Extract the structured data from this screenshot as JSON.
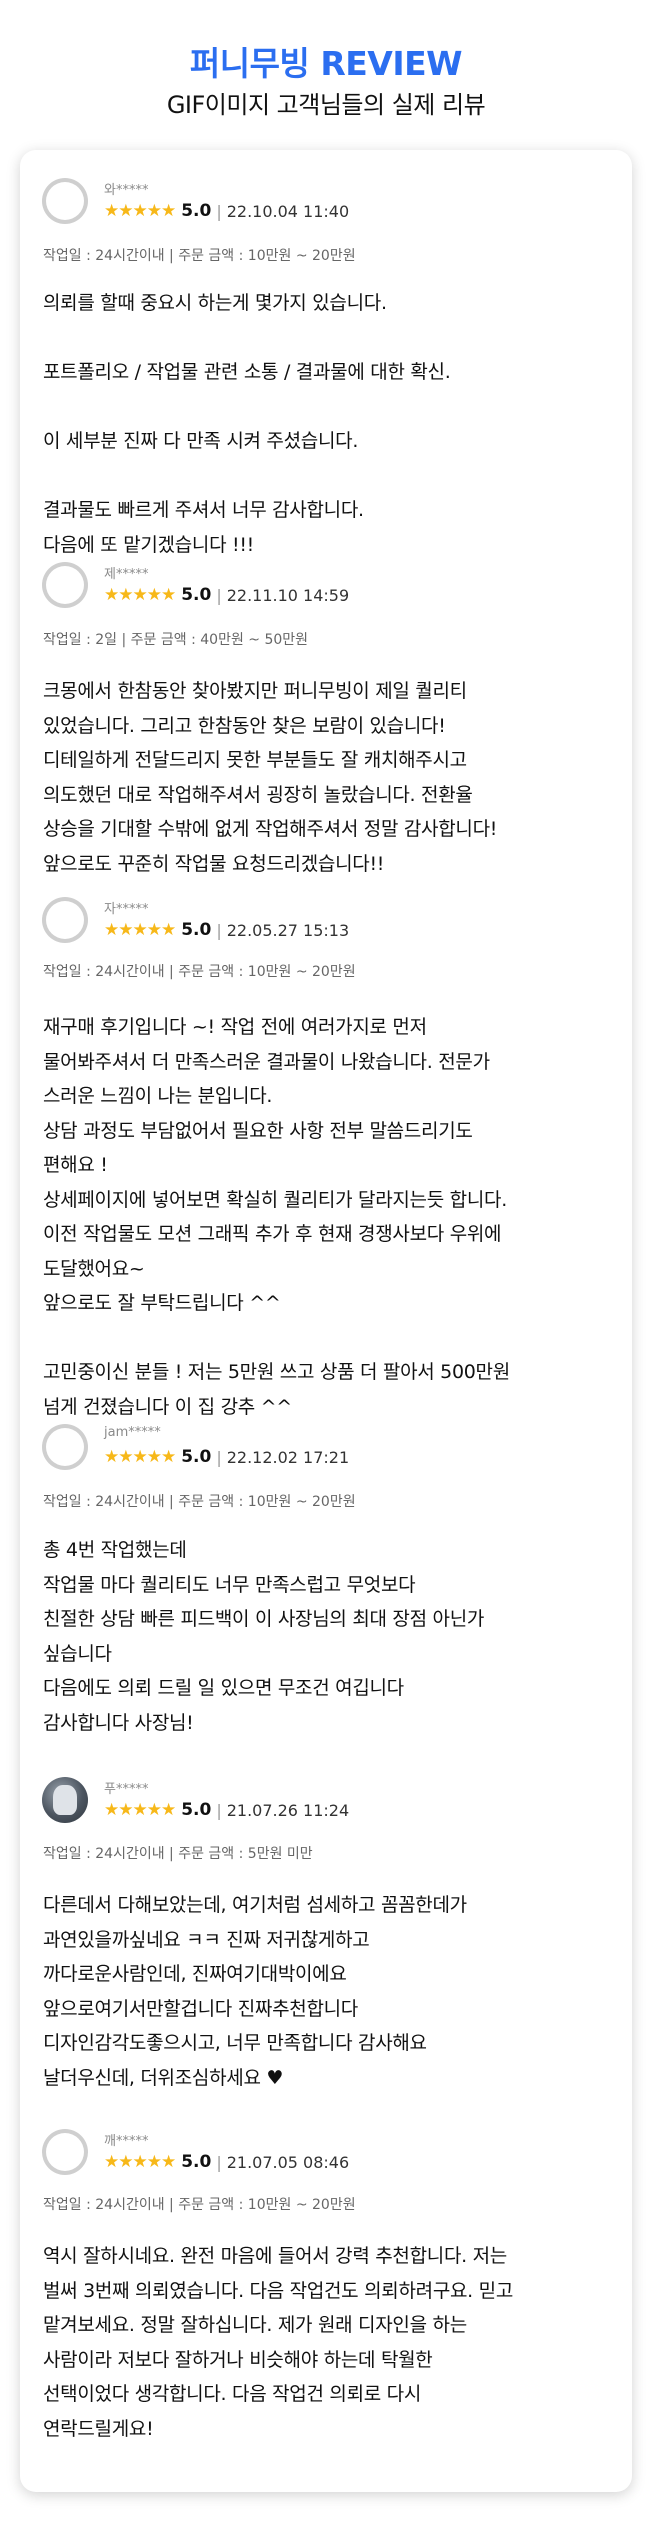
{
  "header": {
    "brand": "퍼니무빙 REVIEW",
    "subtitle": "GIF이미지 고객님들의 실제 리뷰"
  },
  "colors": {
    "brand": "#2b6ef0",
    "star": "#f7b819"
  },
  "reviews": [
    {
      "name": "와*****",
      "stars": "★★★★★",
      "score": "5.0",
      "separator": "|",
      "date": "22.10.04 11:40",
      "meta": "작업일 : 24시간이내 | 주문 금액 : 10만원 ~ 20만원",
      "lines": [
        "의뢰를 할때 중요시 하는게 몇가지 있습니다.",
        "",
        "포트폴리오 / 작업물 관련 소통 / 결과물에 대한 확신.",
        "",
        "이 세부분 진짜 다 만족 시켜 주셨습니다.",
        "",
        "결과물도 빠르게 주셔서 너무 감사합니다.",
        "다음에 또 맡기겠습니다 !!!"
      ]
    },
    {
      "name": "제*****",
      "stars": "★★★★★",
      "score": "5.0",
      "separator": "|",
      "date": "22.11.10 14:59",
      "meta": "작업일 : 2일 | 주문 금액 : 40만원 ~ 50만원",
      "lines": [
        "크몽에서 한참동안 찾아봤지만 퍼니무빙이 제일 퀄리티",
        "있었습니다. 그리고 한참동안 찾은 보람이 있습니다!",
        "디테일하게 전달드리지 못한 부분들도 잘 캐치해주시고",
        "의도했던 대로 작업해주셔서 굉장히 놀랐습니다. 전환율",
        "상승을 기대할 수밖에 없게 작업해주셔서 정말 감사합니다!",
        "앞으로도 꾸준히 작업물 요청드리겠습니다!!"
      ]
    },
    {
      "name": "자*****",
      "stars": "★★★★★",
      "score": "5.0",
      "separator": "|",
      "date": "22.05.27 15:13",
      "meta": "작업일 : 24시간이내 | 주문 금액 : 10만원 ~ 20만원",
      "lines": [
        "재구매 후기입니다 ~! 작업 전에 여러가지로 먼저",
        "물어봐주셔서 더 만족스러운 결과물이 나왔습니다. 전문가",
        "스러운 느낌이 나는 분입니다.",
        "상담 과정도 부담없어서 필요한 사항 전부 말씀드리기도",
        "편해요 !",
        "상세페이지에 넣어보면 확실히 퀄리티가 달라지는듯 합니다.",
        "이전 작업물도 모션 그래픽 추가 후 현재 경쟁사보다 우위에",
        "도달했어요~",
        "앞으로도 잘 부탁드립니다 ^^",
        "",
        "고민중이신 분들 ! 저는 5만원 쓰고 상품 더 팔아서 500만원",
        "넘게 건졌습니다 이 집 강추 ^^"
      ]
    },
    {
      "name": "jam*****",
      "stars": "★★★★★",
      "score": "5.0",
      "separator": "|",
      "date": "22.12.02 17:21",
      "meta": "작업일 : 24시간이내 | 주문 금액 : 10만원 ~ 20만원",
      "lines": [
        "총 4번 작업했는데",
        "작업물 마다 퀄리티도 너무 만족스럽고 무엇보다",
        "친절한 상담 빠른 피드백이 이 사장님의 최대 장점 아닌가",
        "싶습니다",
        "다음에도 의뢰 드릴 일 있으면 무조건 여깁니다",
        "감사합니다 사장님!"
      ]
    },
    {
      "name": "푸*****",
      "stars": "★★★★★",
      "score": "5.0",
      "separator": "|",
      "date": "21.07.26 11:24",
      "meta": "작업일 : 24시간이내 | 주문 금액 : 5만원 미만",
      "lines": [
        "다른데서 다해보았는데, 여기처럼 섬세하고 꼼꼼한데가",
        "과연있을까싶네요 ㅋㅋ 진짜 저귀찮게하고",
        "까다로운사람인데, 진짜여기대박이에요",
        "앞으로여기서만할겁니다 진짜추천합니다",
        "디자인감각도좋으시고, 너무 만족합니다 감사해요",
        "날더우신데, 더위조심하세요 ♥"
      ]
    },
    {
      "name": "깨*****",
      "stars": "★★★★★",
      "score": "5.0",
      "separator": "|",
      "date": "21.07.05 08:46",
      "meta": "작업일 : 24시간이내 | 주문 금액 : 10만원 ~ 20만원",
      "lines": [
        "역시 잘하시네요. 완전 마음에 들어서 강력 추천합니다. 저는",
        "벌써 3번째 의뢰였습니다. 다음 작업건도 의뢰하려구요. 믿고",
        "맡겨보세요. 정말 잘하십니다. 제가 원래 디자인을 하는",
        "사람이라 저보다 잘하거나 비슷해야 하는데 탁월한",
        "선택이었다 생각합니다. 다음 작업건 의뢰로 다시",
        "연락드릴게요!"
      ]
    }
  ]
}
